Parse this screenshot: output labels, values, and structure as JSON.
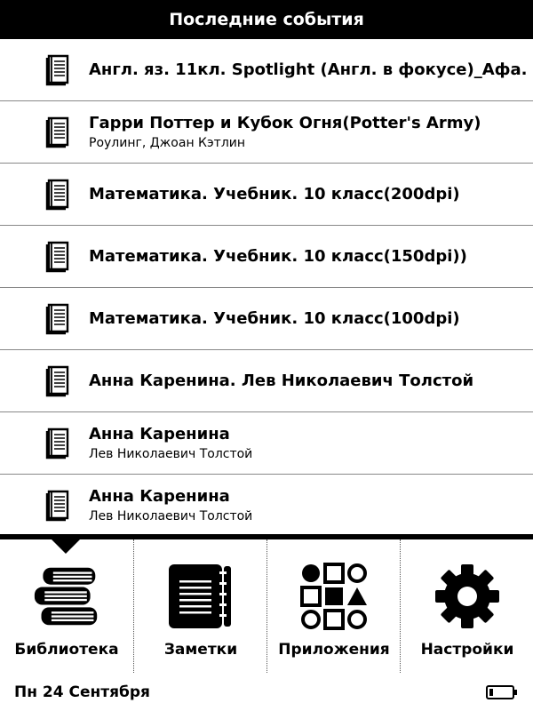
{
  "header": {
    "title": "Последние события"
  },
  "recent_items": [
    {
      "title": "Англ. яз. 11кл. Spotlight (Англ. в фокусе)_Афа....",
      "author": ""
    },
    {
      "title": "Гарри Поттер и Кубок Огня(Potter's Army)",
      "author": "Роулинг, Джоан Кэтлин"
    },
    {
      "title": "Математика. Учебник. 10 класс(200dpi)",
      "author": ""
    },
    {
      "title": "Математика. Учебник. 10 класс(150dpi))",
      "author": ""
    },
    {
      "title": "Математика. Учебник. 10 класс(100dpi)",
      "author": ""
    },
    {
      "title": "Анна Каренина. Лев Николаевич Толстой",
      "author": ""
    },
    {
      "title": "Анна Каренина",
      "author": "Лев Николаевич Толстой"
    },
    {
      "title": "Анна Каренина",
      "author": "Лев Николаевич Толстой"
    }
  ],
  "tabs": [
    {
      "label": "Библиотека",
      "icon": "library-books-icon",
      "selected": true
    },
    {
      "label": "Заметки",
      "icon": "notes-icon",
      "selected": false
    },
    {
      "label": "Приложения",
      "icon": "apps-icon",
      "selected": false
    },
    {
      "label": "Настройки",
      "icon": "settings-gear-icon",
      "selected": false
    }
  ],
  "status": {
    "date": "Пн 24 Сентября",
    "battery_icon": "battery-low-icon"
  }
}
